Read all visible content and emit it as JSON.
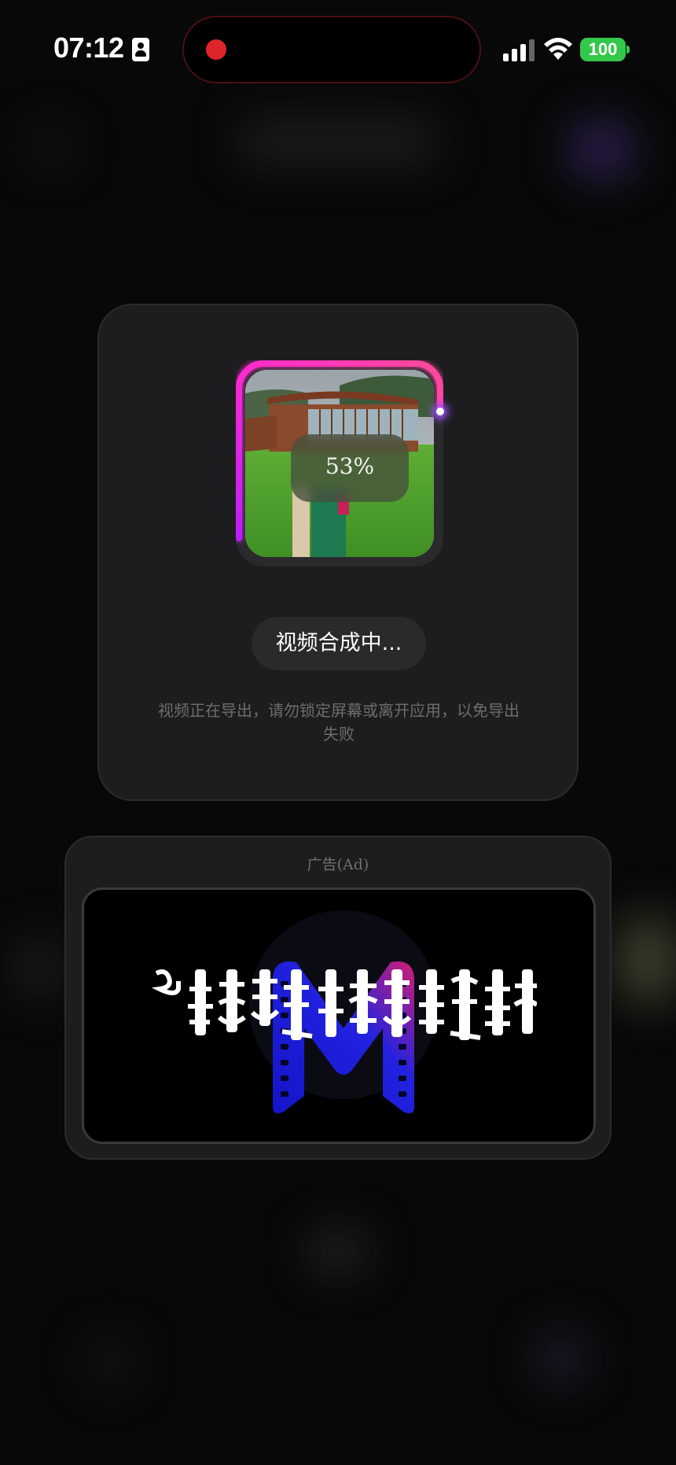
{
  "status_bar": {
    "time": "07:12",
    "battery": "100"
  },
  "export_card": {
    "progress_label": "53%",
    "progress_fraction": 0.53,
    "status_chip": "视频合成中...",
    "hint": "视频正在导出，请勿锁定屏幕或离开应用，以免导出失败"
  },
  "ad_card": {
    "label": "广告(Ad)"
  },
  "colors": {
    "recording_dot": "#e0242b",
    "battery_green": "#33c84a",
    "progress_magenta": "#e020c0",
    "progress_purple": "#9b4dff",
    "logo_blue": "#1a1ad0",
    "logo_pink": "#d0207a"
  }
}
